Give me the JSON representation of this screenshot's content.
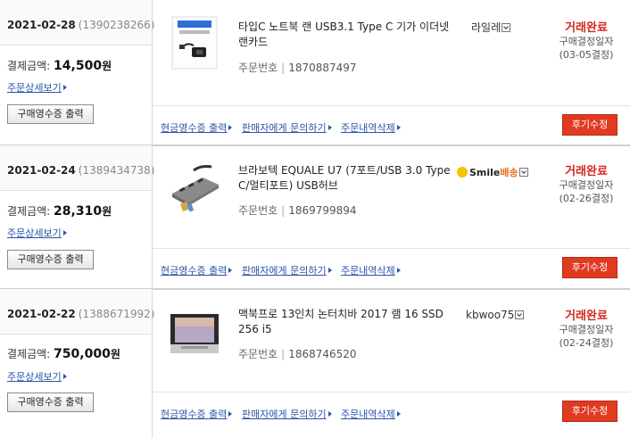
{
  "labels": {
    "pay_label": "결제금액:",
    "won": "원",
    "detail_link": "주문상세보기",
    "receipt_button": "구매영수증 출력",
    "order_no_label": "주문번호",
    "cash_receipt": "현금영수증 출력",
    "ask_seller": "판매자에게 문의하기",
    "delete_order": "주문내역삭제",
    "review_button": "후기수정"
  },
  "orders": [
    {
      "date": "2021-02-28",
      "order_no": "(1390238266)",
      "amount": "14,500",
      "product_name": "타입C 노트북 랜 USB3.1 Type C 기가 이더넷 랜카드",
      "product_order_no": "1870887497",
      "seller": "라일레",
      "status": "거래완료",
      "status_sub": "구매결정일자",
      "status_date": "(03-05결정)",
      "thumb": "usb-c-lan-adapter"
    },
    {
      "date": "2021-02-24",
      "order_no": "(1389434738)",
      "amount": "28,310",
      "product_name": "브라보텍 EQUALE U7 (7포트/USB 3.0 Type C/멀티포트) USB허브",
      "product_order_no": "1869799894",
      "seller_logo_text": "Smile",
      "seller_logo_sub": "배송",
      "status": "거래완료",
      "status_sub": "구매결정일자",
      "status_date": "(02-26결정)",
      "thumb": "usb-hub"
    },
    {
      "date": "2021-02-22",
      "order_no": "(1388671992)",
      "amount": "750,000",
      "product_name": "맥북프로 13인치 논터치바 2017 램 16 SSD 256 i5",
      "product_order_no": "1868746520",
      "seller": "kbwoo75",
      "status": "거래완료",
      "status_sub": "구매결정일자",
      "status_date": "(02-24결정)",
      "thumb": "macbook"
    }
  ],
  "colors": {
    "status_red": "#d6261b",
    "link_blue": "#2a55a8",
    "review_red": "#e03a21",
    "smile_yellow": "#f3c400"
  }
}
